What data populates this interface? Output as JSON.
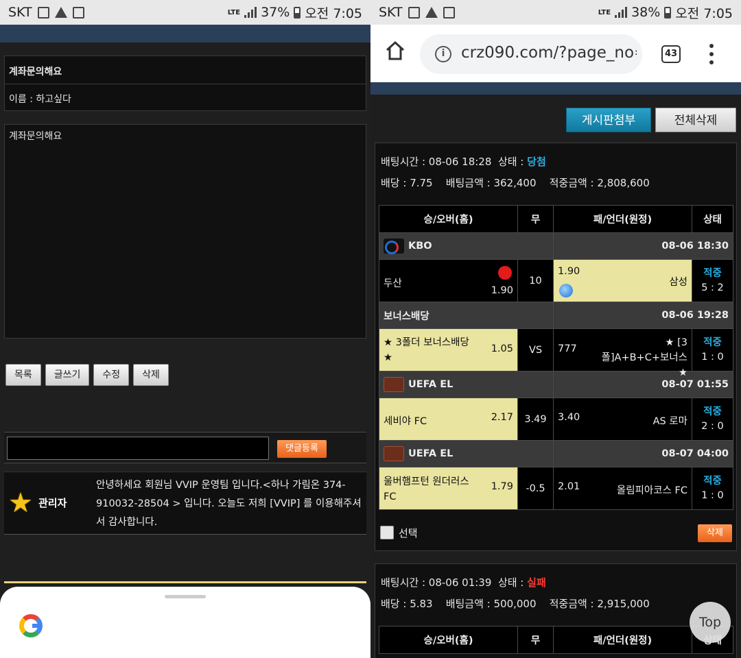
{
  "left": {
    "status": {
      "carrier": "SKT",
      "net": "LTE",
      "battery": "37%",
      "time": "오전 7:05"
    },
    "post": {
      "title": "계좌문의해요",
      "name_line": "이름 : 하고싶다",
      "body": "계좌문의해요"
    },
    "buttons": {
      "list": "목록",
      "write": "글쓰기",
      "edit": "수정",
      "delete": "삭제"
    },
    "comment": {
      "submit": "댓글등록",
      "author": "관리자",
      "text": "안녕하세요 회원님 VVIP 운영팀 입니다.<하나 가림온 374-910032-28504 > 입니다. 오늘도 저희 [VVIP] 를 이용해주셔서 감사합니다."
    }
  },
  "right": {
    "status": {
      "carrier": "SKT",
      "net": "LTE",
      "battery": "38%",
      "time": "오전 7:05"
    },
    "browser": {
      "url": "crz090.com/?page_no=",
      "tab_count": "43"
    },
    "actions": {
      "attach": "게시판첨부",
      "delete_all": "전체삭제"
    },
    "table_headers": {
      "home": "승/오버(홈)",
      "draw": "무",
      "away": "패/언더(원정)",
      "status": "상태"
    },
    "slip1": {
      "bet_time_label": "배팅시간 : ",
      "bet_time": "08-06 18:28",
      "state_label": "상태 : ",
      "state": "당첨",
      "odds_label": "배당 : ",
      "odds": "7.75",
      "amount_label": "배팅금액 : ",
      "amount": "362,400",
      "win_label": "적중금액 : ",
      "win": "2,808,600",
      "games": [
        {
          "league": "KBO",
          "date": "08-06 18:30",
          "home": "두산",
          "home_odds": "1.90",
          "draw": "10",
          "away_odds": "1.90",
          "away": "삼성",
          "result": "적중",
          "score": "5 : 2"
        },
        {
          "league": "보너스배당",
          "date": "08-06 19:28",
          "home": "★ 3폴더 보너스배당 ★",
          "home_odds": "1.05",
          "draw": "VS",
          "away_odds": "777",
          "away": "★ [3폴]A+B+C+보너스 ★",
          "result": "적중",
          "score": "1 : 0"
        },
        {
          "league": "UEFA EL",
          "date": "08-07 01:55",
          "home": "세비야 FC",
          "home_odds": "2.17",
          "draw": "3.49",
          "away_odds": "3.40",
          "away": "AS 로마",
          "result": "적중",
          "score": "2 : 0"
        },
        {
          "league": "UEFA EL",
          "date": "08-07 04:00",
          "home": "울버햄프턴 원더러스 FC",
          "home_odds": "1.79",
          "draw": "-0.5",
          "away_odds": "2.01",
          "away": "올림피아코스 FC",
          "result": "적중",
          "score": "1 : 0"
        }
      ],
      "select_label": "선택",
      "delete": "삭제"
    },
    "slip2": {
      "bet_time": "08-06 01:39",
      "state": "실패",
      "odds": "5.83",
      "amount": "500,000",
      "win": "2,915,000"
    },
    "top_button": "Top"
  }
}
